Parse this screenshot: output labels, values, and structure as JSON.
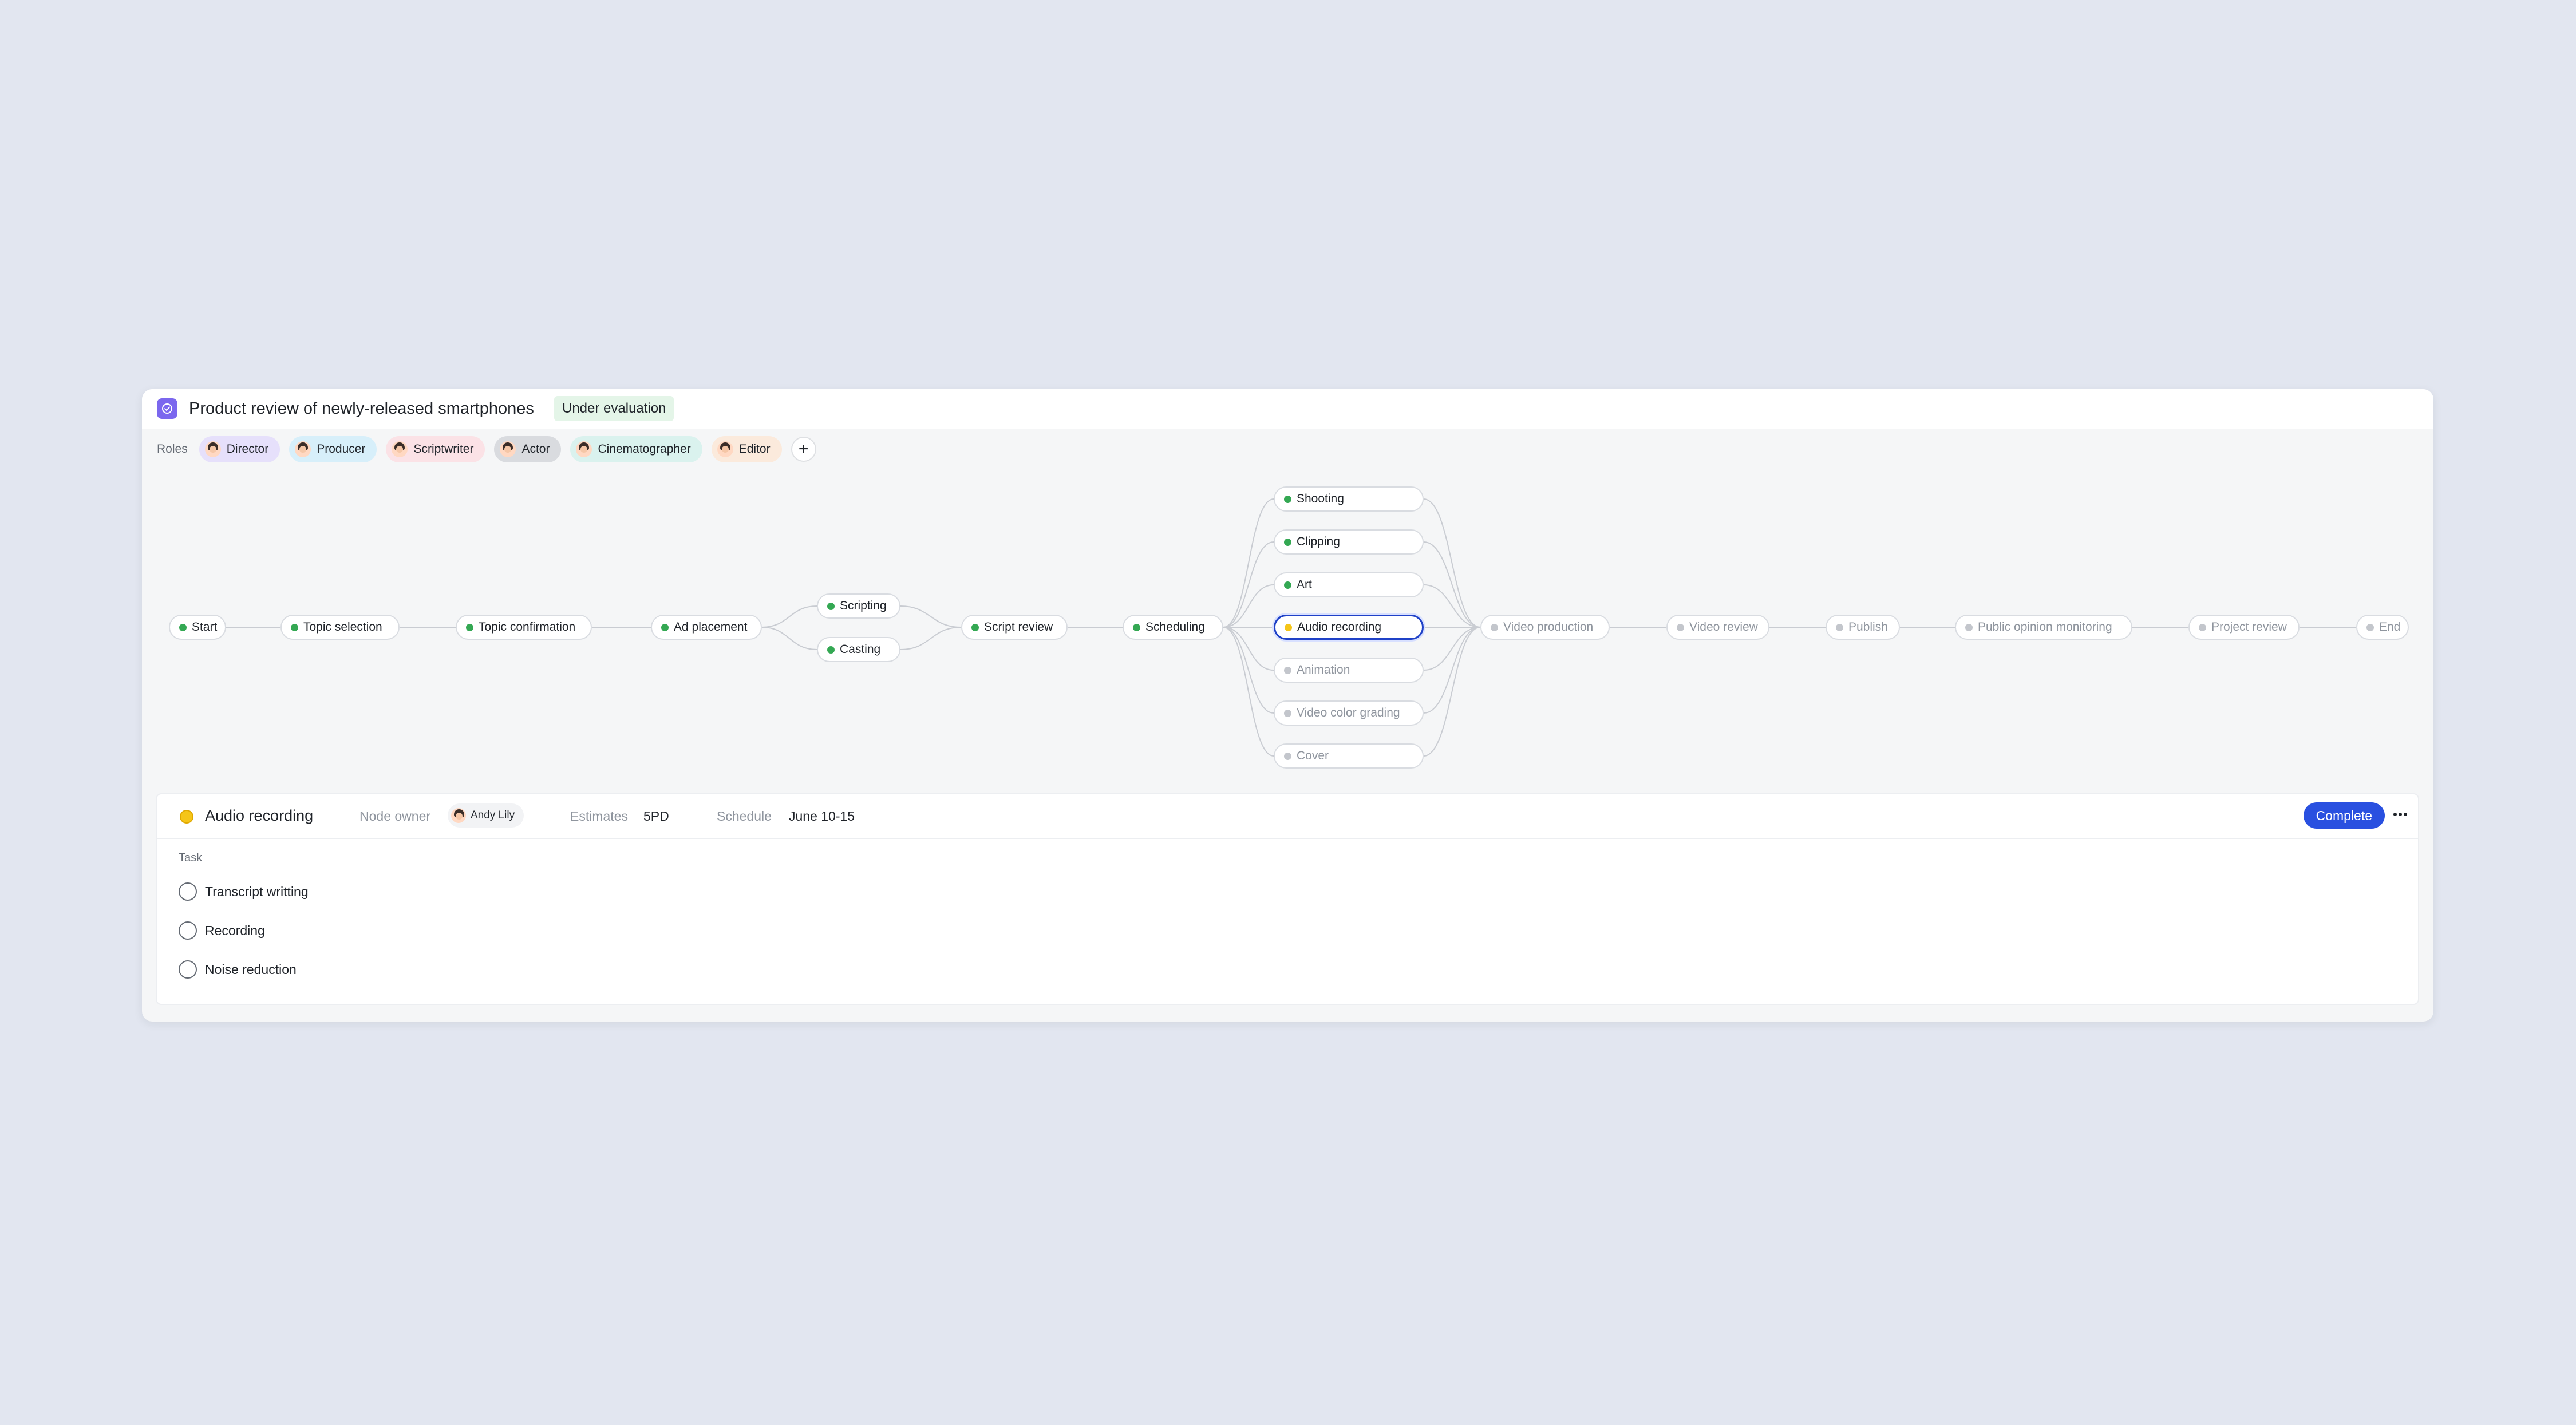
{
  "project": {
    "title": "Product review of newly-released smartphones",
    "status": "Under evaluation",
    "icon": "check-circle-icon",
    "accent_color": "#7b67ee"
  },
  "roles": {
    "label": "Roles",
    "items": [
      {
        "label": "Director",
        "color": "#e6e0fb"
      },
      {
        "label": "Producer",
        "color": "#d7effa"
      },
      {
        "label": "Scriptwriter",
        "color": "#fbe2e6"
      },
      {
        "label": "Actor",
        "color": "#d9dbdf"
      },
      {
        "label": "Cinematographer",
        "color": "#daf2ee"
      },
      {
        "label": "Editor",
        "color": "#fbeadc"
      }
    ],
    "add_icon": "plus-icon"
  },
  "workflow": {
    "status_colors": {
      "done": "#34a853",
      "in_progress": "#f5c518",
      "pending": "#c3c6cc"
    },
    "nodes": [
      {
        "id": "start",
        "label": "Start",
        "status": "done"
      },
      {
        "id": "topic-selection",
        "label": "Topic selection",
        "status": "done"
      },
      {
        "id": "topic-confirmation",
        "label": "Topic confirmation",
        "status": "done"
      },
      {
        "id": "ad-placement",
        "label": "Ad placement",
        "status": "done"
      },
      {
        "id": "scripting",
        "label": "Scripting",
        "status": "done"
      },
      {
        "id": "casting",
        "label": "Casting",
        "status": "done"
      },
      {
        "id": "script-review",
        "label": "Script review",
        "status": "done"
      },
      {
        "id": "scheduling",
        "label": "Scheduling",
        "status": "done"
      },
      {
        "id": "shooting",
        "label": "Shooting",
        "status": "done"
      },
      {
        "id": "clipping",
        "label": "Clipping",
        "status": "done"
      },
      {
        "id": "art",
        "label": "Art",
        "status": "done"
      },
      {
        "id": "audio-recording",
        "label": "Audio recording",
        "status": "in_progress",
        "selected": true
      },
      {
        "id": "animation",
        "label": "Animation",
        "status": "pending"
      },
      {
        "id": "video-color-grading",
        "label": "Video color grading",
        "status": "pending"
      },
      {
        "id": "cover",
        "label": "Cover",
        "status": "pending"
      },
      {
        "id": "video-production",
        "label": "Video production",
        "status": "pending"
      },
      {
        "id": "video-review",
        "label": "Video review",
        "status": "pending"
      },
      {
        "id": "publish",
        "label": "Publish",
        "status": "pending"
      },
      {
        "id": "public-opinion-monitoring",
        "label": "Public opinion monitoring",
        "status": "pending"
      },
      {
        "id": "project-review",
        "label": "Project review",
        "status": "pending"
      },
      {
        "id": "end",
        "label": "End",
        "status": "pending"
      }
    ],
    "edges": [
      [
        "start",
        "topic-selection"
      ],
      [
        "topic-selection",
        "topic-confirmation"
      ],
      [
        "topic-confirmation",
        "ad-placement"
      ],
      [
        "ad-placement",
        "scripting"
      ],
      [
        "ad-placement",
        "casting"
      ],
      [
        "scripting",
        "script-review"
      ],
      [
        "casting",
        "script-review"
      ],
      [
        "script-review",
        "scheduling"
      ],
      [
        "scheduling",
        "shooting"
      ],
      [
        "scheduling",
        "clipping"
      ],
      [
        "scheduling",
        "art"
      ],
      [
        "scheduling",
        "audio-recording"
      ],
      [
        "scheduling",
        "animation"
      ],
      [
        "scheduling",
        "video-color-grading"
      ],
      [
        "scheduling",
        "cover"
      ],
      [
        "shooting",
        "video-production"
      ],
      [
        "clipping",
        "video-production"
      ],
      [
        "art",
        "video-production"
      ],
      [
        "audio-recording",
        "video-production"
      ],
      [
        "animation",
        "video-production"
      ],
      [
        "video-color-grading",
        "video-production"
      ],
      [
        "cover",
        "video-production"
      ],
      [
        "video-production",
        "video-review"
      ],
      [
        "video-review",
        "publish"
      ],
      [
        "publish",
        "public-opinion-monitoring"
      ],
      [
        "public-opinion-monitoring",
        "project-review"
      ],
      [
        "project-review",
        "end"
      ]
    ]
  },
  "detail": {
    "title": "Audio recording",
    "owner_label": "Node owner",
    "owner_name": "Andy Lily",
    "estimates_label": "Estimates",
    "estimates_value": "5PD",
    "schedule_label": "Schedule",
    "schedule_value": "June 10-15",
    "complete_label": "Complete",
    "more_icon": "more-horizontal-icon",
    "task_label": "Task",
    "tasks": [
      "Transcript writting",
      "Recording",
      "Noise reduction"
    ]
  }
}
